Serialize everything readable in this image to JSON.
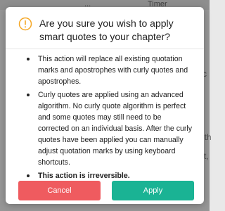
{
  "background": {
    "toolbar_items": [
      "...",
      "Timer"
    ],
    "snippets": [
      "c",
      "ith",
      "t,"
    ]
  },
  "dialog": {
    "icon": "warning-circle-icon",
    "title": "Are you sure you wish to apply smart quotes to your chapter?",
    "items": [
      "This action will replace all existing quotation marks and apostrophes with curly quotes and apostrophes.",
      "Curly quotes are applied using an advanced algorithm. No curly quote algorithm is perfect and some quotes may still need to be corrected on an individual basis. After the curly quotes have been applied you can manually adjust quotation marks by using keyboard shortcuts.",
      "This action is irreversible."
    ],
    "cancel_label": "Cancel",
    "apply_label": "Apply"
  },
  "colors": {
    "warning": "#f5a623",
    "cancel": "#ef5b5f",
    "apply": "#1ab394"
  }
}
